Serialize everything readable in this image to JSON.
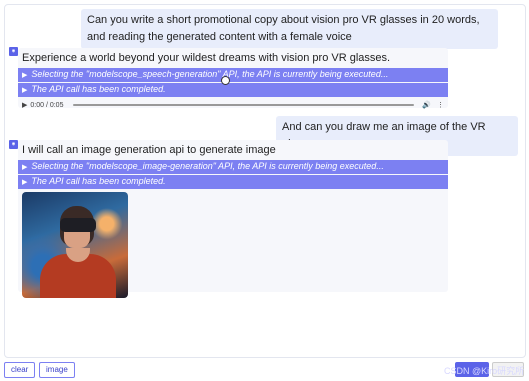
{
  "chat": {
    "msg1_user": "Can you write a short promotional copy about vision pro VR glasses in 20 words, and reading the generated content with a female voice",
    "msg1_bot": "Experience a world beyond your wildest dreams with vision pro VR glasses.",
    "msg1_api_running": "Selecting the \"modelscope_speech-generation\" API, the API is currently being executed...",
    "msg1_api_done": "The API call has been completed.",
    "audio_time": "0:00 / 0:05",
    "msg2_user": "And can you draw me an image of the VR glasses",
    "msg2_bot": "I will call an image generation api to generate image",
    "msg2_api_running": "Selecting the \"modelscope_image-generation\" API, the API is currently being executed...",
    "msg2_api_done": "The API call has been completed."
  },
  "toolbar": {
    "clear_label": "clear",
    "image_label": "image"
  },
  "watermark": "CSDN @Kiro研究所",
  "icons": {
    "bot": "bot-avatar-icon",
    "play": "play-icon",
    "volume": "volume-icon",
    "menu": "more-icon",
    "expand": "triangle-right-icon"
  },
  "colors": {
    "accent": "#5b63e8",
    "api_bar": "#7c80f2",
    "user_bubble": "#e8edfb"
  }
}
